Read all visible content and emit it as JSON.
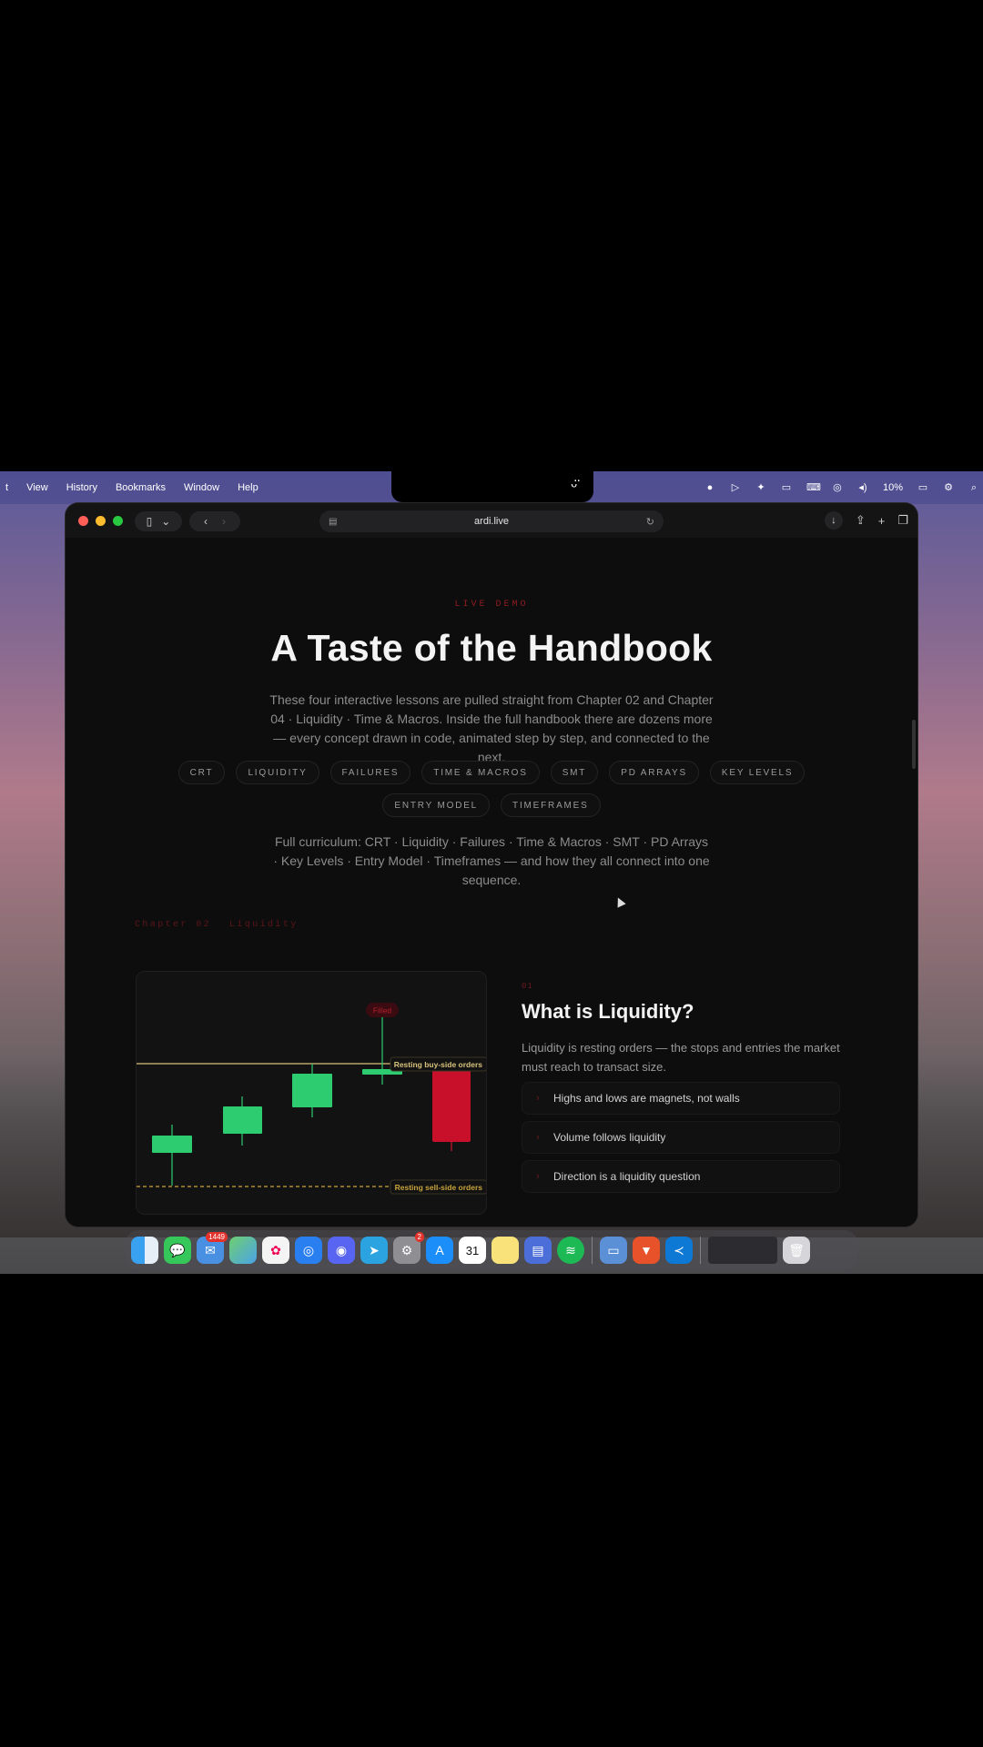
{
  "menubar": {
    "items": [
      "t",
      "View",
      "History",
      "Bookmarks",
      "Window",
      "Help"
    ],
    "battery": "10%"
  },
  "browser": {
    "url": "ardi.live"
  },
  "page": {
    "eyebrow": "LIVE DEMO",
    "title": "A Taste of the Handbook",
    "lede": "These four interactive lessons are pulled straight from Chapter 02 and Chapter 04 · Liquidity · Time & Macros. Inside the full handbook there are dozens more — every concept drawn in code, animated step by step, and connected to the next.",
    "chips": [
      "CRT",
      "LIQUIDITY",
      "FAILURES",
      "TIME & MACROS",
      "SMT",
      "PD ARRAYS",
      "KEY LEVELS",
      "ENTRY MODEL",
      "TIMEFRAMES"
    ],
    "curriculum": "Full curriculum: CRT · Liquidity · Failures · Time & Macros · SMT · PD Arrays · Key Levels · Entry Model · Timeframes — and how they all connect into one sequence.",
    "chapter": {
      "number": "Chapter 02",
      "name": "Liquidity"
    }
  },
  "chart_data": {
    "type": "candlestick",
    "annotations": [
      "Filled",
      "Resting buy-side orders",
      "Resting sell-side orders"
    ],
    "colors": {
      "bull": "#2ecc71",
      "bear": "#d0122a",
      "buyside": "#d8c27a",
      "sellside": "#c9a43a"
    }
  },
  "lesson": {
    "number": "01",
    "title": "What is Liquidity?",
    "description": "Liquidity is resting orders — the stops and entries the market must reach to transact size.",
    "points": [
      "Highs and lows are magnets, not walls",
      "Volume follows liquidity",
      "Direction is a liquidity question"
    ]
  },
  "dock": {
    "apps": [
      "finder-icon",
      "messages-icon",
      "mail-icon",
      "maps-icon",
      "photos-icon",
      "safari-icon",
      "discord-icon",
      "telegram-icon",
      "settings-icon",
      "app-store-icon",
      "calendar-icon",
      "notes-icon",
      "preview-icon",
      "spotify-icon",
      "downloads-icon",
      "brave-icon",
      "vscode-icon",
      "window-thumbnail",
      "trash-icon"
    ],
    "mail_badge": "1449",
    "settings_badge": "2",
    "calendar_date": "31"
  }
}
